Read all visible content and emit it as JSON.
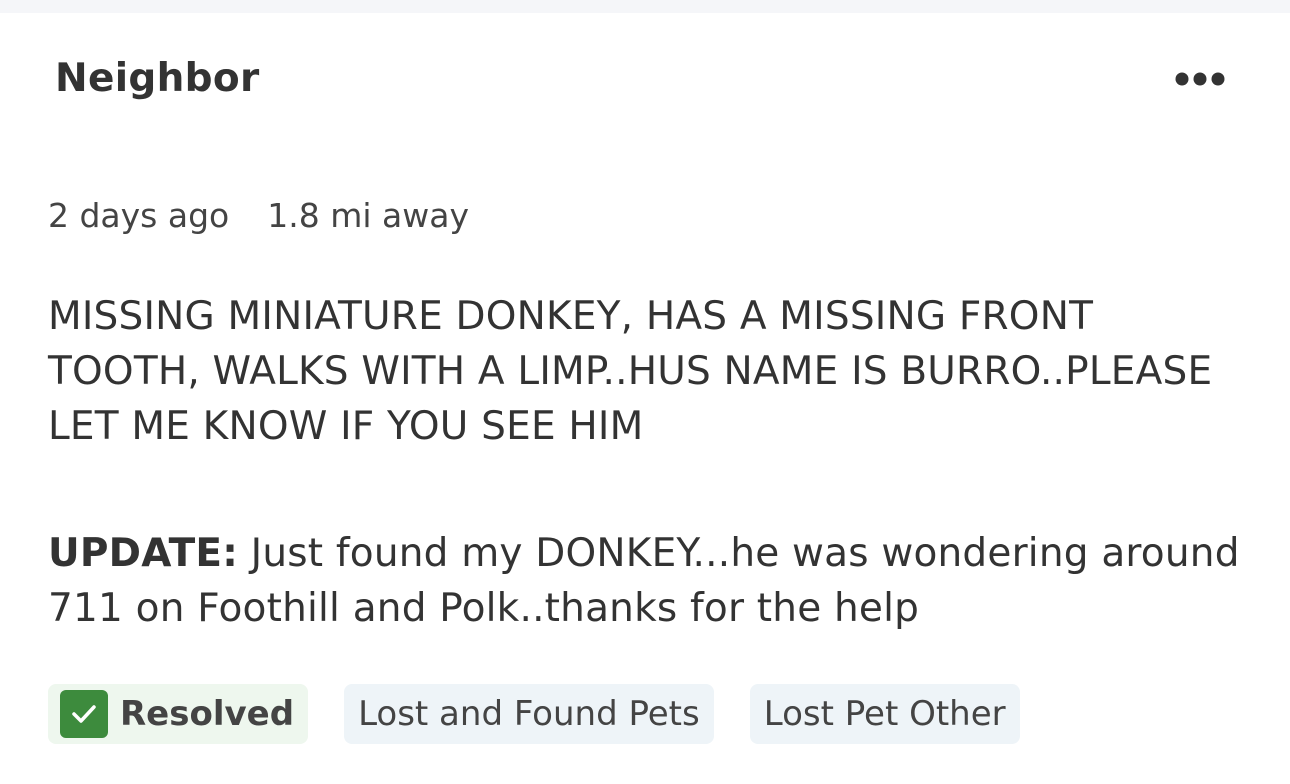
{
  "post": {
    "author": "Neighbor",
    "time_ago": "2 days ago",
    "distance": "1.8 mi away",
    "body": "MISSING MINIATURE DONKEY,  HAS A MISSING FRONT TOOTH,  WALKS WITH A LIMP..HUS NAME IS BURRO..PLEASE LET ME KNOW IF YOU SEE HIM",
    "update_label": "UPDATE:",
    "update_text": " Just found my DONKEY...he was wondering around 711 on Foothill and Polk..thanks for the help",
    "more_icon": "more-dots-icon"
  },
  "tags": {
    "resolved": {
      "label": "Resolved",
      "icon": "check-icon",
      "color": "#3d8b3d"
    },
    "topic1": "Lost and Found Pets",
    "topic2": "Lost Pet Other"
  }
}
